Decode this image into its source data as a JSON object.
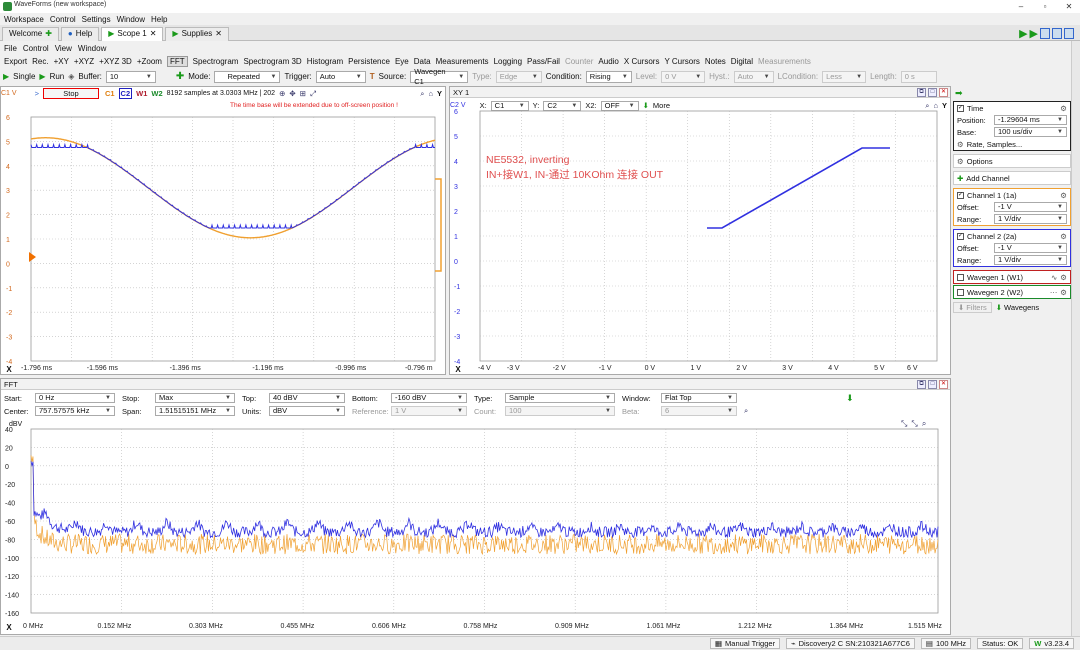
{
  "app": {
    "title": "WaveForms (new workspace)",
    "menu": [
      "Workspace",
      "Control",
      "Settings",
      "Window",
      "Help"
    ],
    "min": "–",
    "max": "▫",
    "close": "✕"
  },
  "tabs": [
    {
      "label": "Welcome"
    },
    {
      "label": "Help"
    },
    {
      "label": "Scope 1"
    },
    {
      "label": "Supplies"
    }
  ],
  "submenu": [
    "File",
    "Control",
    "View",
    "Window"
  ],
  "toolbar": [
    "Export",
    "Rec.",
    "+XY",
    "+XYZ",
    "+XYZ 3D",
    "+Zoom",
    "FFT",
    "Spectrogram",
    "Spectrogram 3D",
    "Histogram",
    "Persistence",
    "Eye",
    "Data",
    "Measurements",
    "Logging",
    "Pass/Fail",
    "Counter",
    "Audio",
    "X Cursors",
    "Y Cursors",
    "Notes",
    "Digital",
    "Measurements"
  ],
  "ctrl": {
    "single": "Single",
    "run": "Run",
    "buffer_label": "Buffer:",
    "buffer": "10",
    "mode_label": "Mode:",
    "mode": "Repeated",
    "trigger_label": "Trigger:",
    "trigger": "Auto",
    "source_label": "Source:",
    "source": "Wavegen C1",
    "type_label": "Type:",
    "type": "Edge",
    "condition_label": "Condition:",
    "condition": "Rising",
    "level_label": "Level:",
    "level": "0 V",
    "hyst_label": "Hyst.:",
    "hyst": "Auto",
    "lcond_label": "LCondition:",
    "lcond": "Less",
    "length_label": "Length:",
    "length": "0 s"
  },
  "scope": {
    "ch1_label": "C1 V",
    "stop": "Stop",
    "c1": "C1",
    "c2": "C2",
    "w1": "W1",
    "w2": "W2",
    "info": "8192 samples at 3.0303 MHz | 202",
    "warning": "The time base will be extended due to off-screen position !",
    "yticks": [
      "6",
      "5",
      "4",
      "3",
      "2",
      "1",
      "0",
      "-1",
      "-2",
      "-3",
      "-4"
    ],
    "xticks": [
      "-1.796 ms",
      "-1.596 ms",
      "-1.396 ms",
      "-1.196 ms",
      "-0.996 ms",
      "-0.796 m"
    ],
    "x": "X",
    "y": "Y",
    "colors": {
      "c1": "#f0a030",
      "c2": "#3030e0"
    }
  },
  "xy": {
    "title": "XY 1",
    "ch2": "C2 V",
    "x_label": "X:",
    "x_val": "C1",
    "y_label": "Y:",
    "y_val": "C2",
    "x2_label": "X2:",
    "x2_val": "OFF",
    "more": "More",
    "annotation1": "NE5532, inverting",
    "annotation2": "IN+接W1, IN-通过 10KOhm 连接 OUT",
    "yticks": [
      "6",
      "5",
      "4",
      "3",
      "2",
      "1",
      "0",
      "-1",
      "-2",
      "-3",
      "-4"
    ],
    "xticks": [
      "-4 V",
      "-3 V",
      "-2 V",
      "-1 V",
      "0 V",
      "1 V",
      "2 V",
      "3 V",
      "4 V",
      "5 V",
      "6 V"
    ]
  },
  "fft": {
    "title": "FFT",
    "start_label": "Start:",
    "start": "0 Hz",
    "stop_label": "Stop:",
    "stop": "Max",
    "top_label": "Top:",
    "top": "40 dBV",
    "bottom_label": "Bottom:",
    "bottom": "-160 dBV",
    "type_label": "Type:",
    "type": "Sample",
    "window_label": "Window:",
    "window": "Flat Top",
    "center_label": "Center:",
    "center": "757.57575 kHz",
    "span_label": "Span:",
    "span": "1.51515151 MHz",
    "units_label": "Units:",
    "units": "dBV",
    "ref_label": "Reference:",
    "ref": "1 V",
    "count_label": "Count:",
    "count": "100",
    "beta_label": "Beta:",
    "beta": "6",
    "ylabel": "dBV",
    "yticks": [
      "40",
      "20",
      "0",
      "-20",
      "-40",
      "-60",
      "-80",
      "-100",
      "-120",
      "-140",
      "-160"
    ],
    "xticks": [
      "0 MHz",
      "0.152 MHz",
      "0.303 MHz",
      "0.455 MHz",
      "0.606 MHz",
      "0.758 MHz",
      "0.909 MHz",
      "1.061 MHz",
      "1.212 MHz",
      "1.364 MHz",
      "1.515 MHz"
    ],
    "x": "X"
  },
  "right": {
    "time": "Time",
    "position_label": "Position:",
    "position": "-1.29604 ms",
    "base_label": "Base:",
    "base": "100 us/div",
    "rate": "Rate, Samples...",
    "options": "Options",
    "add_channel": "Add Channel",
    "ch1": "Channel 1 (1a)",
    "ch1_offset_label": "Offset:",
    "ch1_offset": "-1 V",
    "ch1_range_label": "Range:",
    "ch1_range": "1 V/div",
    "ch2": "Channel 2 (2a)",
    "ch2_offset_label": "Offset:",
    "ch2_offset": "-1 V",
    "ch2_range_label": "Range:",
    "ch2_range": "1 V/div",
    "wg1": "Wavegen 1 (W1)",
    "wg2": "Wavegen 2 (W2)",
    "filters": "Filters",
    "wavegens": "Wavegens"
  },
  "status": {
    "manual": "Manual Trigger",
    "device": "Discovery2 C SN:210321A677C6",
    "freq": "100 MHz",
    "status": "Status: OK",
    "version": "v3.23.4"
  }
}
